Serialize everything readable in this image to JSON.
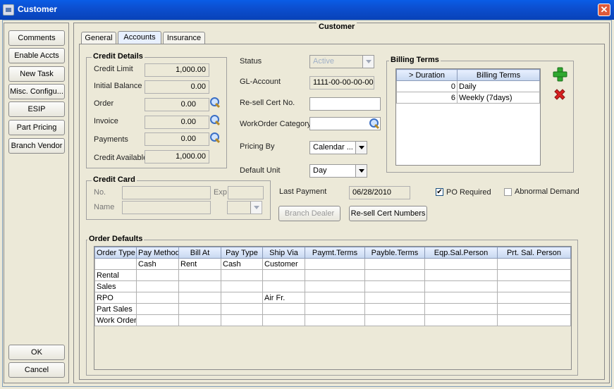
{
  "window": {
    "title": "Customer",
    "panel_title": "Customer"
  },
  "sidebar": {
    "buttons": [
      "Comments",
      "Enable Accts",
      "New Task",
      "Misc. Configu...",
      "ESIP",
      "Part Pricing",
      "Branch Vendor"
    ],
    "ok": "OK",
    "cancel": "Cancel"
  },
  "tabs": [
    "General",
    "Accounts",
    "Insurance"
  ],
  "active_tab": "Accounts",
  "credit_details": {
    "legend": "Credit Details",
    "credit_limit_label": "Credit Limit",
    "credit_limit": "1,000.00",
    "initial_balance_label": "Initial Balance",
    "initial_balance": "0.00",
    "order_label": "Order",
    "order": "0.00",
    "invoice_label": "Invoice",
    "invoice": "0.00",
    "payments_label": "Payments",
    "payments": "0.00",
    "credit_available_label": "Credit Available",
    "credit_available": "1,000.00"
  },
  "middle": {
    "status_label": "Status",
    "status": "Active",
    "gl_account_label": "GL-Account",
    "gl_account": "1111-00-00-00-00",
    "resell_label": "Re-sell Cert No.",
    "resell": "",
    "workorder_label": "WorkOrder Category",
    "workorder": "",
    "pricing_label": "Pricing By",
    "pricing": "Calendar ...",
    "default_unit_label": "Default Unit",
    "default_unit": "Day",
    "last_payment_label": "Last Payment",
    "last_payment": "06/28/2010",
    "po_required_label": "PO Required",
    "po_required": true,
    "abnormal_label": "Abnormal Demand",
    "abnormal": false,
    "branch_dealer_btn": "Branch Dealer",
    "resell_numbers_btn": "Re-sell Cert Numbers"
  },
  "billing_terms": {
    "legend": "Billing Terms",
    "columns": [
      "> Duration",
      "Billing Terms"
    ],
    "rows": [
      [
        "0",
        "Daily"
      ],
      [
        "6",
        "Weekly (7days)"
      ]
    ]
  },
  "credit_card": {
    "legend": "Credit Card",
    "no_label": "No.",
    "no": "",
    "exp_label": "Exp",
    "exp": "",
    "name_label": "Name",
    "name": ""
  },
  "order_defaults": {
    "legend": "Order Defaults",
    "columns": [
      "Order Type",
      "Pay Method",
      "Bill At",
      "Pay Type",
      "Ship Via",
      "Paymt.Terms",
      "Payble.Terms",
      "Eqp.Sal.Person",
      "Prt. Sal. Person"
    ],
    "rows": [
      [
        "",
        "Cash",
        "Rent",
        "Cash",
        "Customer",
        "",
        "",
        "",
        ""
      ],
      [
        "Rental",
        "",
        "",
        "",
        "",
        "",
        "",
        "",
        ""
      ],
      [
        "Sales",
        "",
        "",
        "",
        "",
        "",
        "",
        "",
        ""
      ],
      [
        "RPO",
        "",
        "",
        "",
        "Air Fr.",
        "",
        "",
        "",
        ""
      ],
      [
        "Part Sales",
        "",
        "",
        "",
        "",
        "",
        "",
        "",
        ""
      ],
      [
        "Work Order",
        "",
        "",
        "",
        "",
        "",
        "",
        "",
        ""
      ]
    ]
  },
  "icons": {
    "add": "plus-icon",
    "delete": "x-icon",
    "lookup": "magnifier-icon"
  },
  "colors": {
    "titlebar": "#0c4fd0",
    "add_icon": "#2fa82f",
    "delete_icon": "#d82020",
    "table_header": "#c8d8f0"
  }
}
